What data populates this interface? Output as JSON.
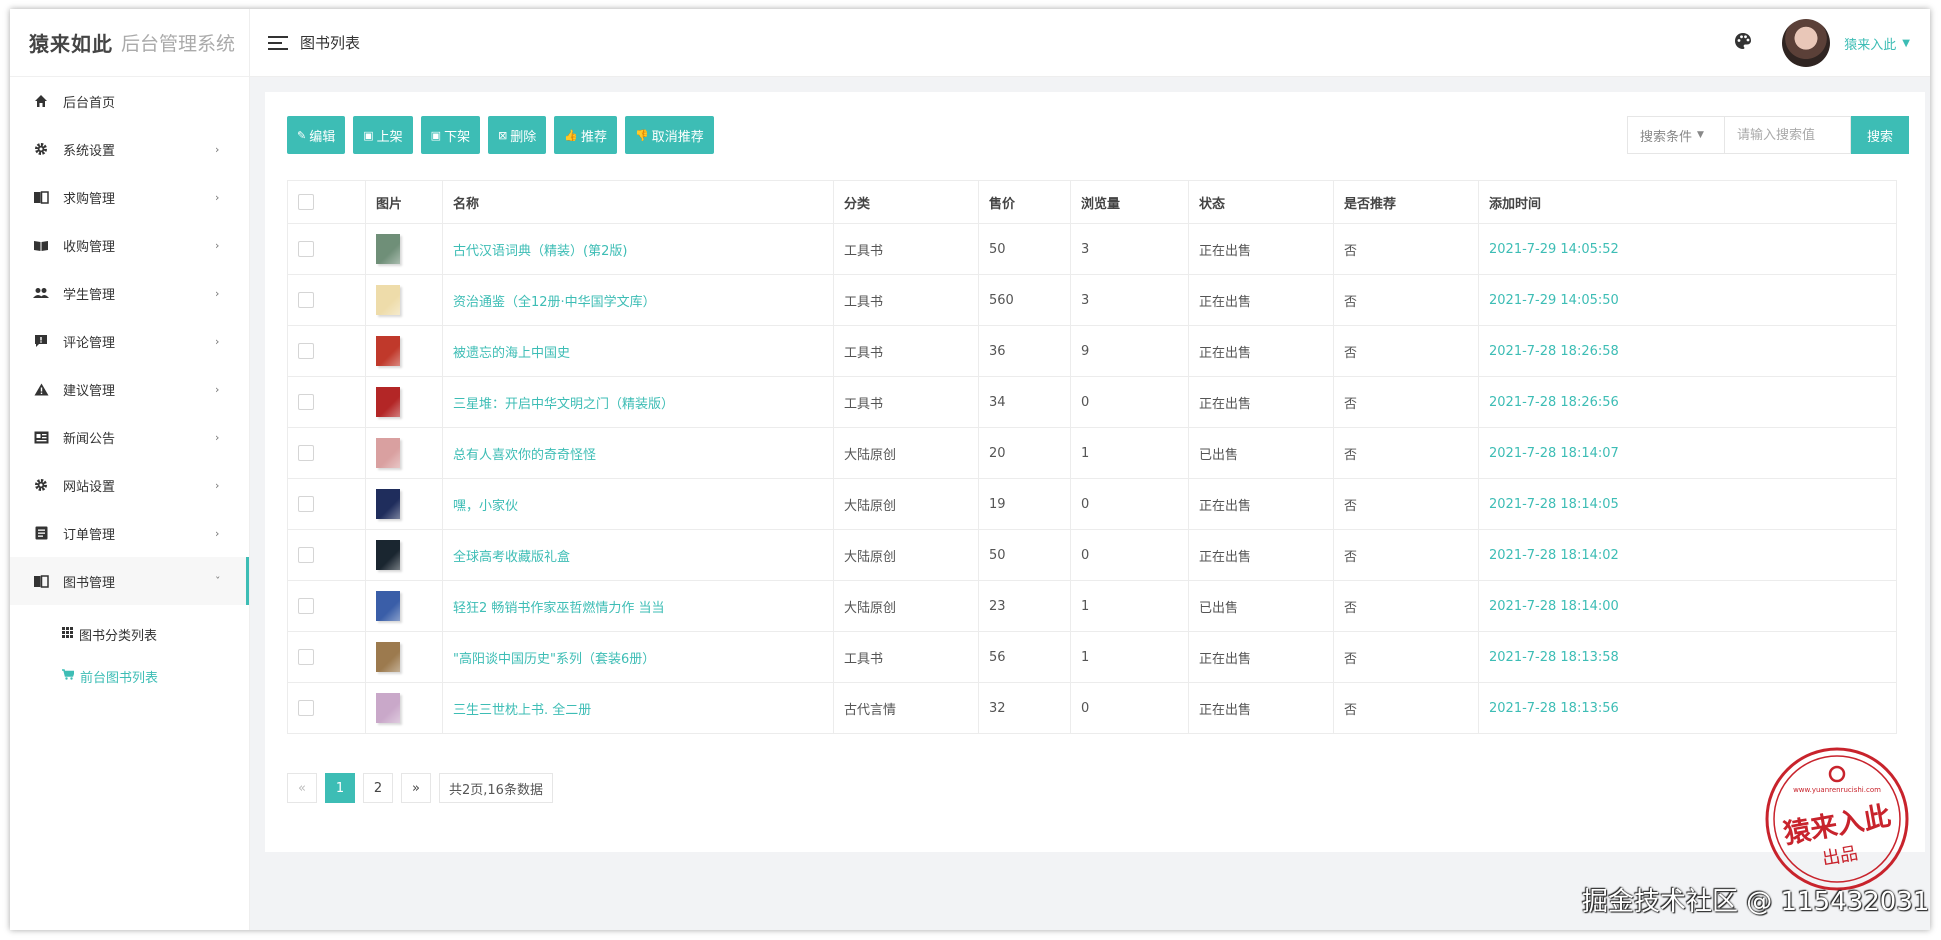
{
  "brand": {
    "name": "猿来如此",
    "subtitle": "后台管理系统"
  },
  "header": {
    "title": "图书列表",
    "user_name": "猿来入此"
  },
  "sidebar": {
    "items": [
      {
        "label": "后台首页",
        "icon": "home-icon"
      },
      {
        "label": "系统设置",
        "icon": "gear-icon"
      },
      {
        "label": "求购管理",
        "icon": "book-open-icon"
      },
      {
        "label": "收购管理",
        "icon": "book-read-icon"
      },
      {
        "label": "学生管理",
        "icon": "users-icon"
      },
      {
        "label": "评论管理",
        "icon": "comment-icon"
      },
      {
        "label": "建议管理",
        "icon": "warning-icon"
      },
      {
        "label": "新闻公告",
        "icon": "news-icon"
      },
      {
        "label": "网站设置",
        "icon": "gear-icon"
      },
      {
        "label": "订单管理",
        "icon": "list-icon"
      },
      {
        "label": "图书管理",
        "icon": "book-open-icon"
      }
    ],
    "subitems": [
      {
        "label": "图书分类列表",
        "icon": "grid-icon"
      },
      {
        "label": "前台图书列表",
        "icon": "cart-icon"
      }
    ]
  },
  "toolbar": {
    "edit": "编辑",
    "on_shelf": "上架",
    "off_shelf": "下架",
    "delete": "删除",
    "recommend": "推荐",
    "unrecommend": "取消推荐"
  },
  "search": {
    "condition_label": "搜索条件",
    "placeholder": "请输入搜索值",
    "button": "搜索"
  },
  "table": {
    "headers": [
      "图片",
      "名称",
      "分类",
      "售价",
      "浏览量",
      "状态",
      "是否推荐",
      "添加时间"
    ],
    "rows": [
      {
        "name": "古代汉语词典（精装）(第2版)",
        "category": "工具书",
        "price": "50",
        "views": "3",
        "status": "正在出售",
        "recommended": "否",
        "added": "2021-7-29 14:05:52",
        "thumb_color": "#6f8f78"
      },
      {
        "name": "资治通鉴（全12册·中华国学文库）",
        "category": "工具书",
        "price": "560",
        "views": "3",
        "status": "正在出售",
        "recommended": "否",
        "added": "2021-7-29 14:05:50",
        "thumb_color": "#eedcaa"
      },
      {
        "name": "被遗忘的海上中国史",
        "category": "工具书",
        "price": "36",
        "views": "9",
        "status": "正在出售",
        "recommended": "否",
        "added": "2021-7-28 18:26:58",
        "thumb_color": "#c0392b"
      },
      {
        "name": "三星堆：开启中华文明之门（精装版）",
        "category": "工具书",
        "price": "34",
        "views": "0",
        "status": "正在出售",
        "recommended": "否",
        "added": "2021-7-28 18:26:56",
        "thumb_color": "#b32626"
      },
      {
        "name": "总有人喜欢你的奇奇怪怪",
        "category": "大陆原创",
        "price": "20",
        "views": "1",
        "status": "已出售",
        "recommended": "否",
        "added": "2021-7-28 18:14:07",
        "thumb_color": "#d9a0a0"
      },
      {
        "name": "嘿，小家伙",
        "category": "大陆原创",
        "price": "19",
        "views": "0",
        "status": "正在出售",
        "recommended": "否",
        "added": "2021-7-28 18:14:05",
        "thumb_color": "#1f2d5c"
      },
      {
        "name": "全球高考收藏版礼盒",
        "category": "大陆原创",
        "price": "50",
        "views": "0",
        "status": "正在出售",
        "recommended": "否",
        "added": "2021-7-28 18:14:02",
        "thumb_color": "#1a2630"
      },
      {
        "name": "轻狂2 畅销书作家巫哲燃情力作 当当",
        "category": "大陆原创",
        "price": "23",
        "views": "1",
        "status": "已出售",
        "recommended": "否",
        "added": "2021-7-28 18:14:00",
        "thumb_color": "#3a5ea8"
      },
      {
        "name": "\"高阳谈中国历史\"系列（套装6册）",
        "category": "工具书",
        "price": "56",
        "views": "1",
        "status": "正在出售",
        "recommended": "否",
        "added": "2021-7-28 18:13:58",
        "thumb_color": "#9c7a4e"
      },
      {
        "name": "三生三世枕上书. 全二册",
        "category": "古代言情",
        "price": "32",
        "views": "0",
        "status": "正在出售",
        "recommended": "否",
        "added": "2021-7-28 18:13:56",
        "thumb_color": "#c9a8c9"
      }
    ]
  },
  "pagination": {
    "prev": "«",
    "pages": [
      "1",
      "2"
    ],
    "current": "1",
    "next": "»",
    "info": "共2页,16条数据"
  },
  "stamp": {
    "text": "猿来入此",
    "sub": "出品",
    "url": "www.yuanrenrucishi.com"
  },
  "watermark": "掘金技术社区 @ 115432031",
  "colors": {
    "accent": "#3dbdb5",
    "stamp": "#c8232c"
  }
}
